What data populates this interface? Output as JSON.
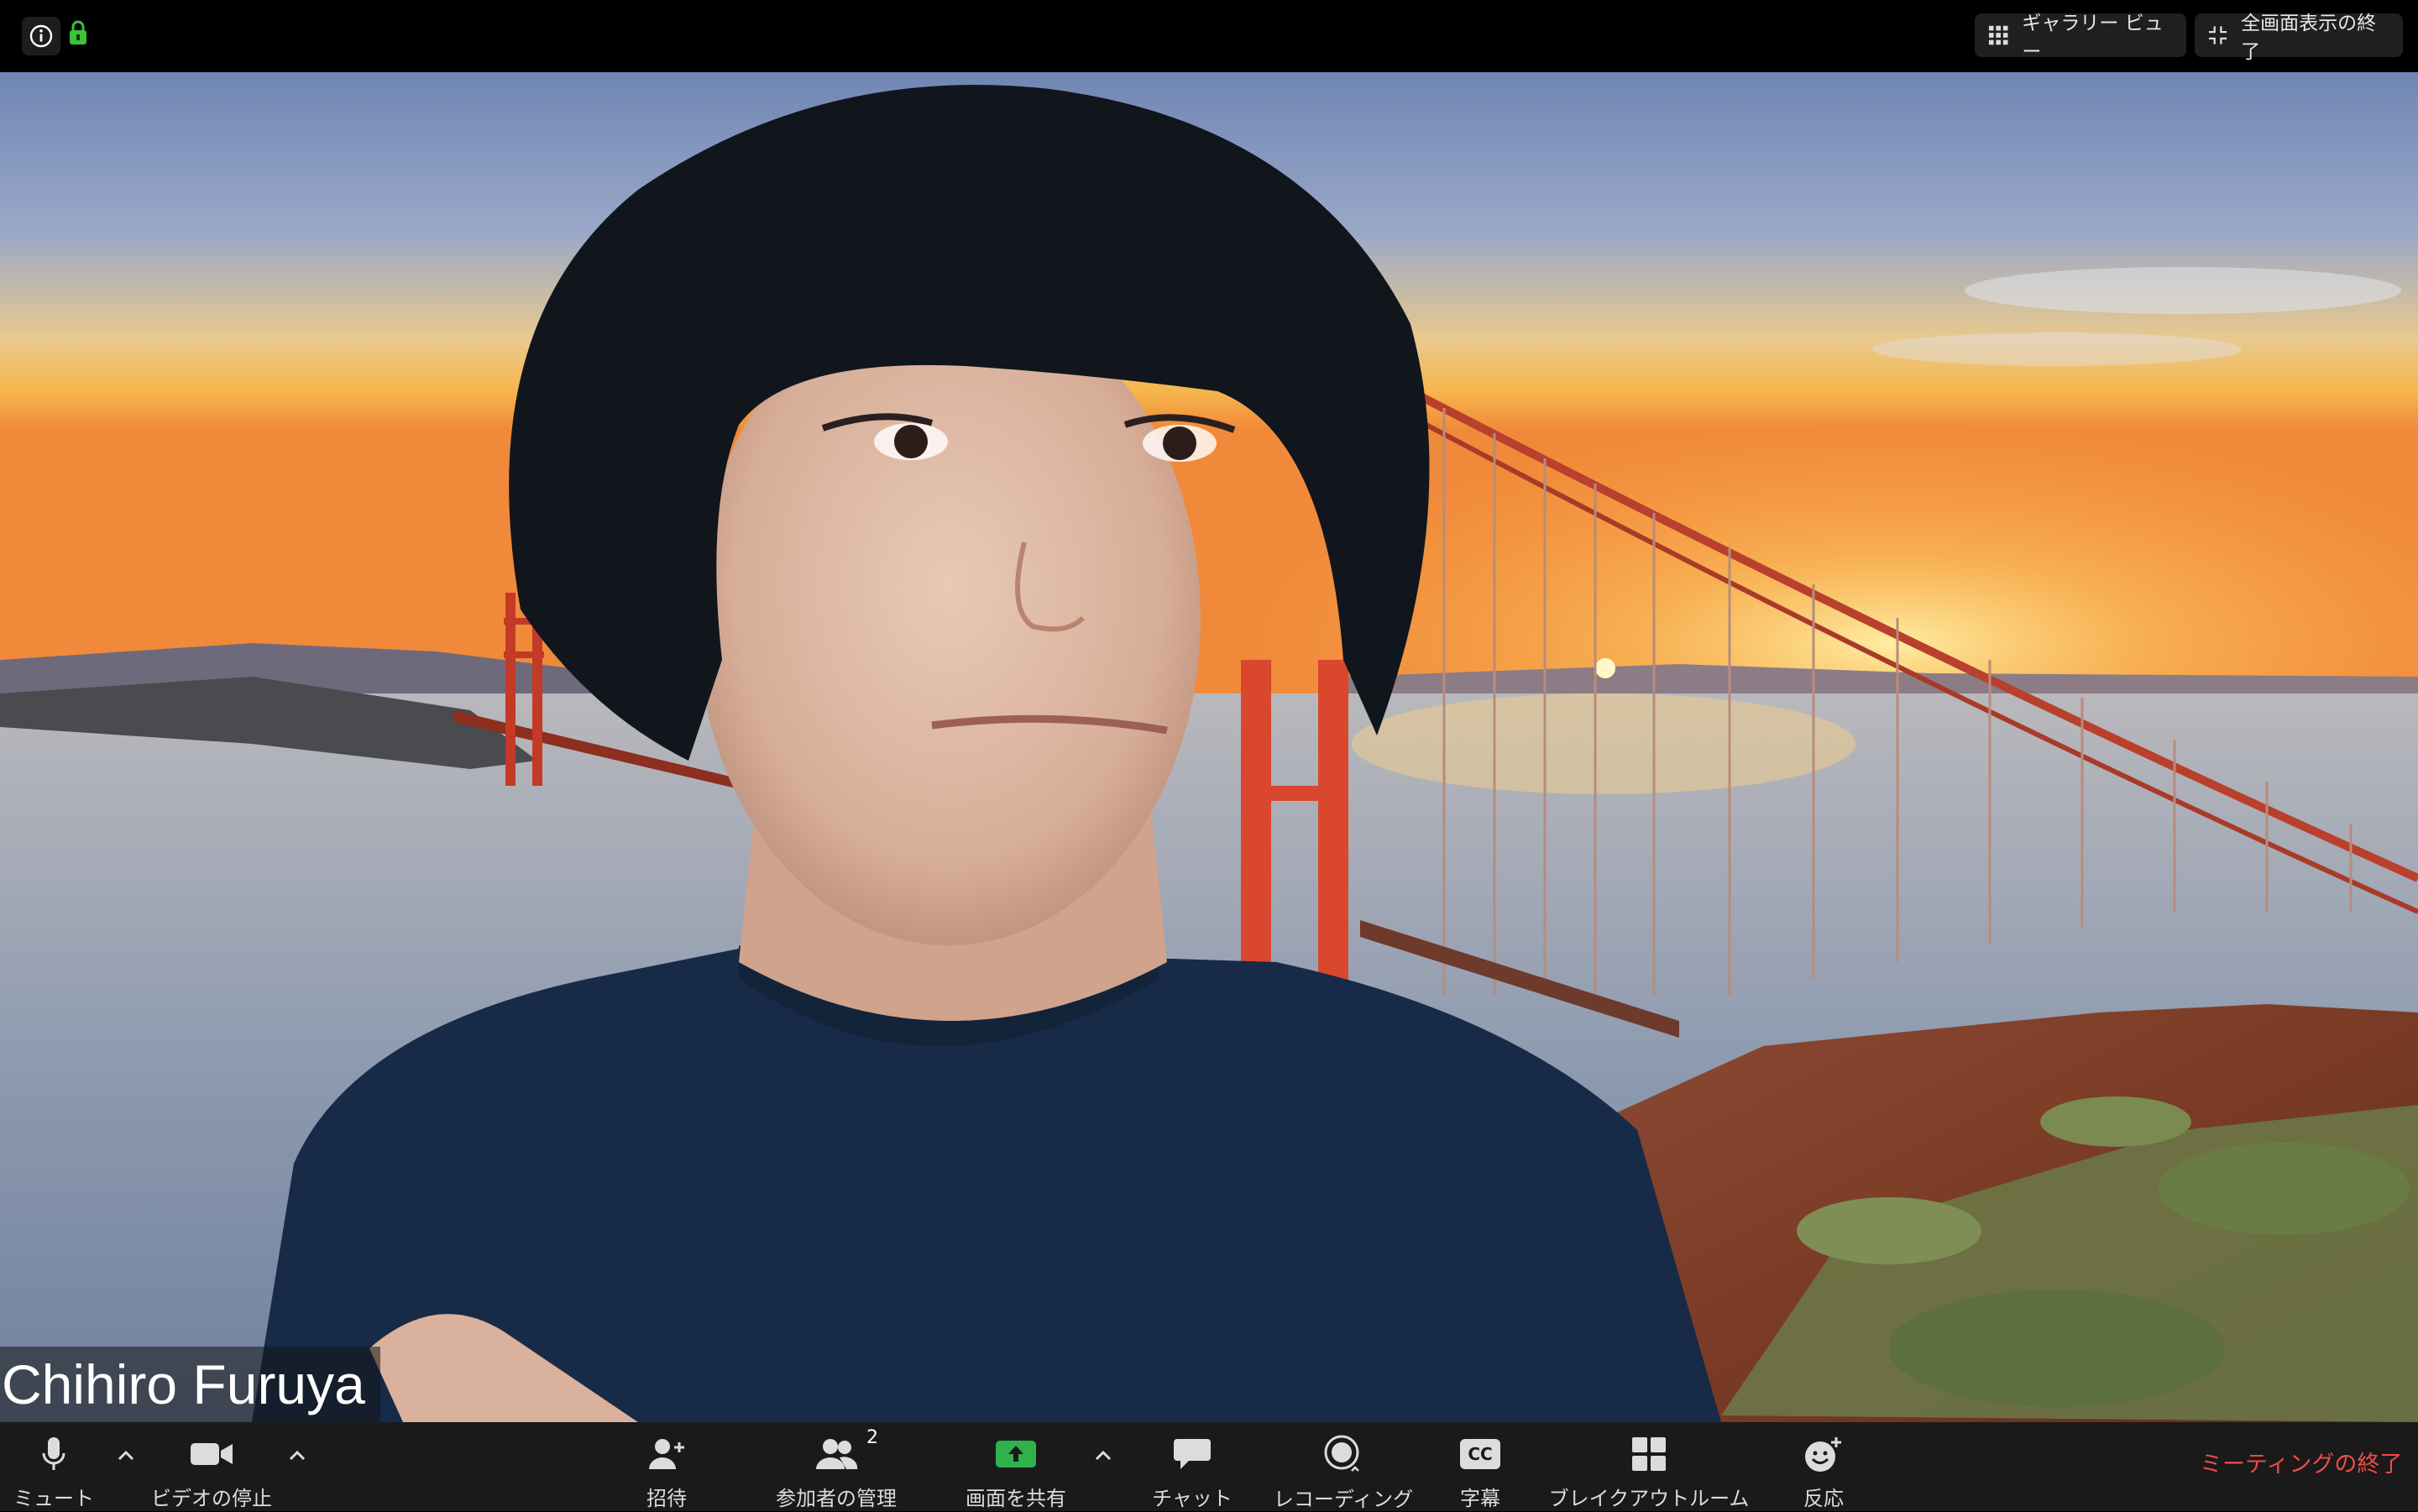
{
  "top_bar": {
    "icons": [
      "info-icon",
      "lock-icon"
    ],
    "gallery_view_label": "ギャラリー ビュー",
    "exit_fullscreen_label": "全画面表示の終了"
  },
  "video": {
    "participant_name": "Chihiro Furuya",
    "virtual_background": "golden-gate-bridge-sunset"
  },
  "toolbar": {
    "mute_label": "ミュート",
    "stop_video_label": "ビデオの停止",
    "invite_label": "招待",
    "participants_label": "参加者の管理",
    "participants_count": "2",
    "share_screen_label": "画面を共有",
    "chat_label": "チャット",
    "recording_label": "レコーディング",
    "captions_label": "字幕",
    "captions_icon_text": "CC",
    "breakout_label": "ブレイクアウトルーム",
    "reactions_label": "反応",
    "end_meeting_label": "ミーティングの終了"
  },
  "colors": {
    "toolbar_bg": "#1a1a1a",
    "share_green": "#2fb24c",
    "end_red": "#ef4a4a",
    "lock_green": "#3cc13b"
  }
}
